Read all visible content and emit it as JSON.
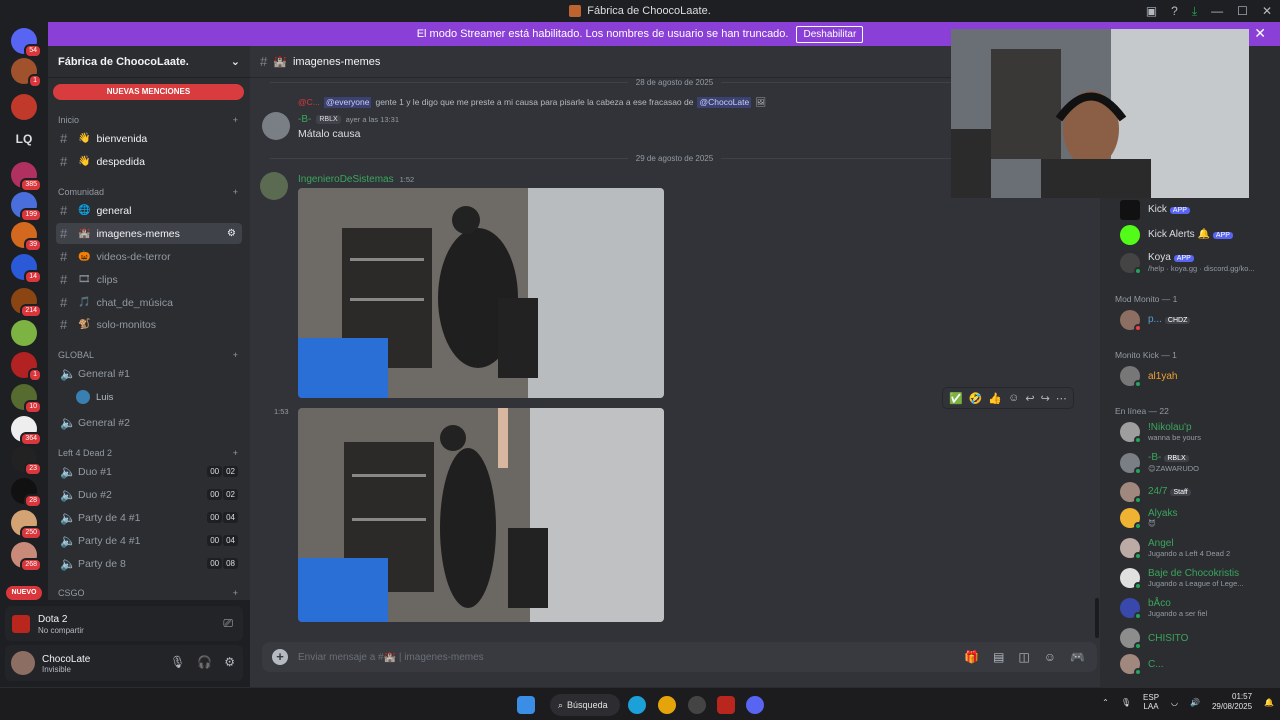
{
  "window": {
    "title": "Fábrica de ChoocoLaate."
  },
  "banner": {
    "text": "El modo Streamer está habilitado. Los nombres de usuario se han truncado.",
    "button": "Deshabilitar",
    "close": "✕"
  },
  "servers": {
    "badges": [
      "54",
      "1",
      "385",
      "199",
      "39",
      "14",
      "214",
      "1",
      "10",
      "364",
      "23",
      "28",
      "250",
      "268"
    ],
    "lq": "LQ",
    "nuevo": "NUEVO"
  },
  "sidebar": {
    "guild_name": "Fábrica de ChoocoLaate.",
    "new_mentions": "NUEVAS MENCIONES",
    "cat_inicio": "Inicio",
    "ch_bienvenida": "bienvenida",
    "ch_despedida": "despedida",
    "cat_comunidad": "Comunidad",
    "ch_general": "general",
    "ch_memes": "imagenes-memes",
    "ch_terror": "videos-de-terror",
    "ch_clips": "clips",
    "ch_musica": "chat_de_música",
    "ch_monitos": "solo-monitos",
    "cat_global": "GLOBAL",
    "vc_general1": "General #1",
    "vc_user": "Luis",
    "vc_general2": "General #2",
    "cat_l4d2": "Left 4 Dead 2",
    "vc_duo1": "Duo #1",
    "vc_duo1_count": [
      "00",
      "02"
    ],
    "vc_duo2": "Duo #2",
    "vc_duo2_count": [
      "00",
      "02"
    ],
    "vc_party1": "Party de 4 #1",
    "vc_party1_count": [
      "00",
      "04"
    ],
    "vc_party2": "Party de 4 #1",
    "vc_party2_count": [
      "00",
      "04"
    ],
    "vc_party8": "Party de 8",
    "vc_party8_count": [
      "00",
      "08"
    ],
    "cat_csgo": "CSGO"
  },
  "activity": {
    "game": "Dota 2",
    "status": "No compartir"
  },
  "user": {
    "name": "ChocoLate",
    "status": "Invisible"
  },
  "channel": {
    "name": "imagenes-memes"
  },
  "messages": {
    "date1": "28 de agosto de 2025",
    "reply_user": "@C...",
    "reply_text_1": "@everyone",
    "reply_text_2": "gente 1 y le digo que me preste a mi causa para pisarle la cabeza a ese fracasao de",
    "reply_mention": "@ChocoLate",
    "msg1_author": "-B-",
    "msg1_tag": "RBLX",
    "msg1_time": "ayer a las 13:31",
    "msg1_text": "Mátalo causa",
    "date2": "29 de agosto de 2025",
    "msg2_author": "IngenieroDeSistemas",
    "msg2_time": "1:52",
    "msg3_time": "1:53"
  },
  "composer": {
    "placeholder": "Enviar mensaje a #🏰 | imagenes-memes"
  },
  "members": {
    "kick": "Kick",
    "kick_tag": "APP",
    "kick_alerts": "Kick Alerts",
    "kick_alerts_tag": "APP",
    "koya": "Koya",
    "koya_tag": "APP",
    "koya_sub": "/help · koya.gg · discord.gg/ko...",
    "cat_mod": "Mod Monito — 1",
    "mod1": "p...",
    "mod1_tag": "CHDZ",
    "cat_monitokick": "Monito Kick — 1",
    "mk1": "al1yah",
    "cat_online": "En línea — 22",
    "on1": "!Nikolau'p",
    "on1_sub": "wanna be yours",
    "on2": "-B-",
    "on2_tag": "RBLX",
    "on2_sub": "😊ZAWARUDO",
    "on3": "24/7",
    "on3_tag": "Staff",
    "on4": "Alyaks",
    "on5": "Angel",
    "on5_sub": "Jugando a Left 4 Dead 2",
    "on6": "Baje de Chocokristis",
    "on6_sub": "Jugando a League of Lege...",
    "on7": "bÅco",
    "on7_sub": "Jugando a ser fiel",
    "on8": "CHISITO",
    "on9": "C..."
  },
  "taskbar": {
    "search": "Búsqueda",
    "lang": "ESP",
    "lang2": "LAA",
    "time": "01:57",
    "date": "29/08/2025"
  },
  "colors": {
    "accent": "#5865f2",
    "banner": "#8a3fd6",
    "mention": "#d83c3e",
    "green_name": "#3ba55c"
  }
}
